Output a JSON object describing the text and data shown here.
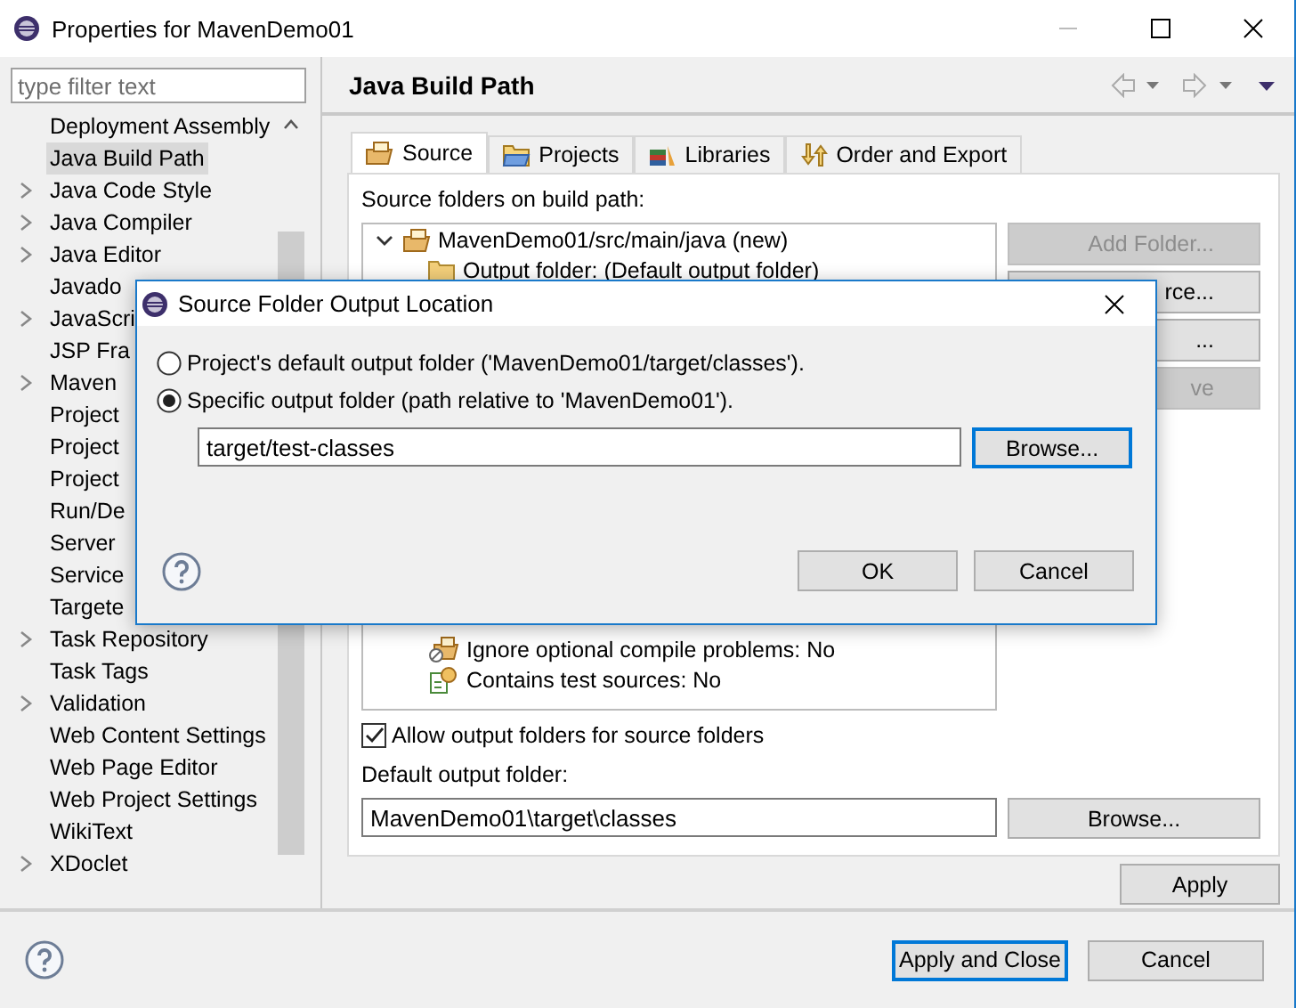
{
  "window": {
    "title": "Properties for MavenDemo01"
  },
  "filter": {
    "placeholder": "type filter text"
  },
  "sidebar": {
    "items": [
      {
        "label": "Deployment Assembly",
        "expandable": false,
        "selected": false
      },
      {
        "label": "Java Build Path",
        "expandable": false,
        "selected": true
      },
      {
        "label": "Java Code Style",
        "expandable": true,
        "selected": false
      },
      {
        "label": "Java Compiler",
        "expandable": true,
        "selected": false
      },
      {
        "label": "Java Editor",
        "expandable": true,
        "selected": false
      },
      {
        "label": "Javado",
        "expandable": false,
        "selected": false
      },
      {
        "label": "JavaScri",
        "expandable": true,
        "selected": false
      },
      {
        "label": "JSP Fra",
        "expandable": false,
        "selected": false
      },
      {
        "label": "Maven",
        "expandable": true,
        "selected": false
      },
      {
        "label": "Project",
        "expandable": false,
        "selected": false
      },
      {
        "label": "Project",
        "expandable": false,
        "selected": false
      },
      {
        "label": "Project",
        "expandable": false,
        "selected": false
      },
      {
        "label": "Run/De",
        "expandable": false,
        "selected": false
      },
      {
        "label": "Server",
        "expandable": false,
        "selected": false
      },
      {
        "label": "Service",
        "expandable": false,
        "selected": false
      },
      {
        "label": "Targete",
        "expandable": false,
        "selected": false
      },
      {
        "label": "Task Repository",
        "expandable": true,
        "selected": false
      },
      {
        "label": "Task Tags",
        "expandable": false,
        "selected": false
      },
      {
        "label": "Validation",
        "expandable": true,
        "selected": false
      },
      {
        "label": "Web Content Settings",
        "expandable": false,
        "selected": false
      },
      {
        "label": "Web Page Editor",
        "expandable": false,
        "selected": false
      },
      {
        "label": "Web Project Settings",
        "expandable": false,
        "selected": false
      },
      {
        "label": "WikiText",
        "expandable": false,
        "selected": false
      },
      {
        "label": "XDoclet",
        "expandable": true,
        "selected": false
      }
    ]
  },
  "page": {
    "title": "Java Build Path",
    "tabs": [
      {
        "label": "Source",
        "kind": "source",
        "selected": true
      },
      {
        "label": "Projects",
        "kind": "projects",
        "selected": false
      },
      {
        "label": "Libraries",
        "kind": "libraries",
        "selected": false
      },
      {
        "label": "Order and Export",
        "kind": "order",
        "selected": false
      }
    ],
    "tree_label": "Source folders on build path:",
    "tree": [
      {
        "label": "MavenDemo01/src/main/java (new)",
        "kind": "package",
        "expanded": true,
        "children": [
          {
            "label": "Output folder: (Default output folder)",
            "kind": "folder"
          },
          {
            "label": "Ignore optional compile problems: No",
            "kind": "ignore"
          },
          {
            "label": "Contains test sources: No",
            "kind": "test"
          }
        ]
      }
    ],
    "side_buttons": [
      {
        "label": "Add Folder...",
        "disabled": true
      },
      {
        "label": "rce...",
        "disabled": false
      },
      {
        "label": "...",
        "disabled": false
      },
      {
        "label": "ve",
        "disabled": true
      }
    ],
    "allow_output": {
      "label": "Allow output folders for source folders",
      "checked": true
    },
    "default_output": {
      "label": "Default output folder:",
      "value": "MavenDemo01\\target\\classes",
      "browse": "Browse..."
    },
    "apply": "Apply"
  },
  "footer": {
    "buttons": [
      {
        "label": "Apply and Close",
        "default": true
      },
      {
        "label": "Cancel",
        "default": false
      }
    ]
  },
  "dialog": {
    "title": "Source Folder Output Location",
    "options": [
      {
        "label": "Project's default output folder ('MavenDemo01/target/classes').",
        "selected": false
      },
      {
        "label": "Specific output folder (path relative to 'MavenDemo01').",
        "selected": true
      }
    ],
    "path": {
      "value": "target/test-classes",
      "browse": "Browse..."
    },
    "buttons": [
      {
        "label": "OK",
        "default": false
      },
      {
        "label": "Cancel",
        "default": false
      }
    ]
  }
}
